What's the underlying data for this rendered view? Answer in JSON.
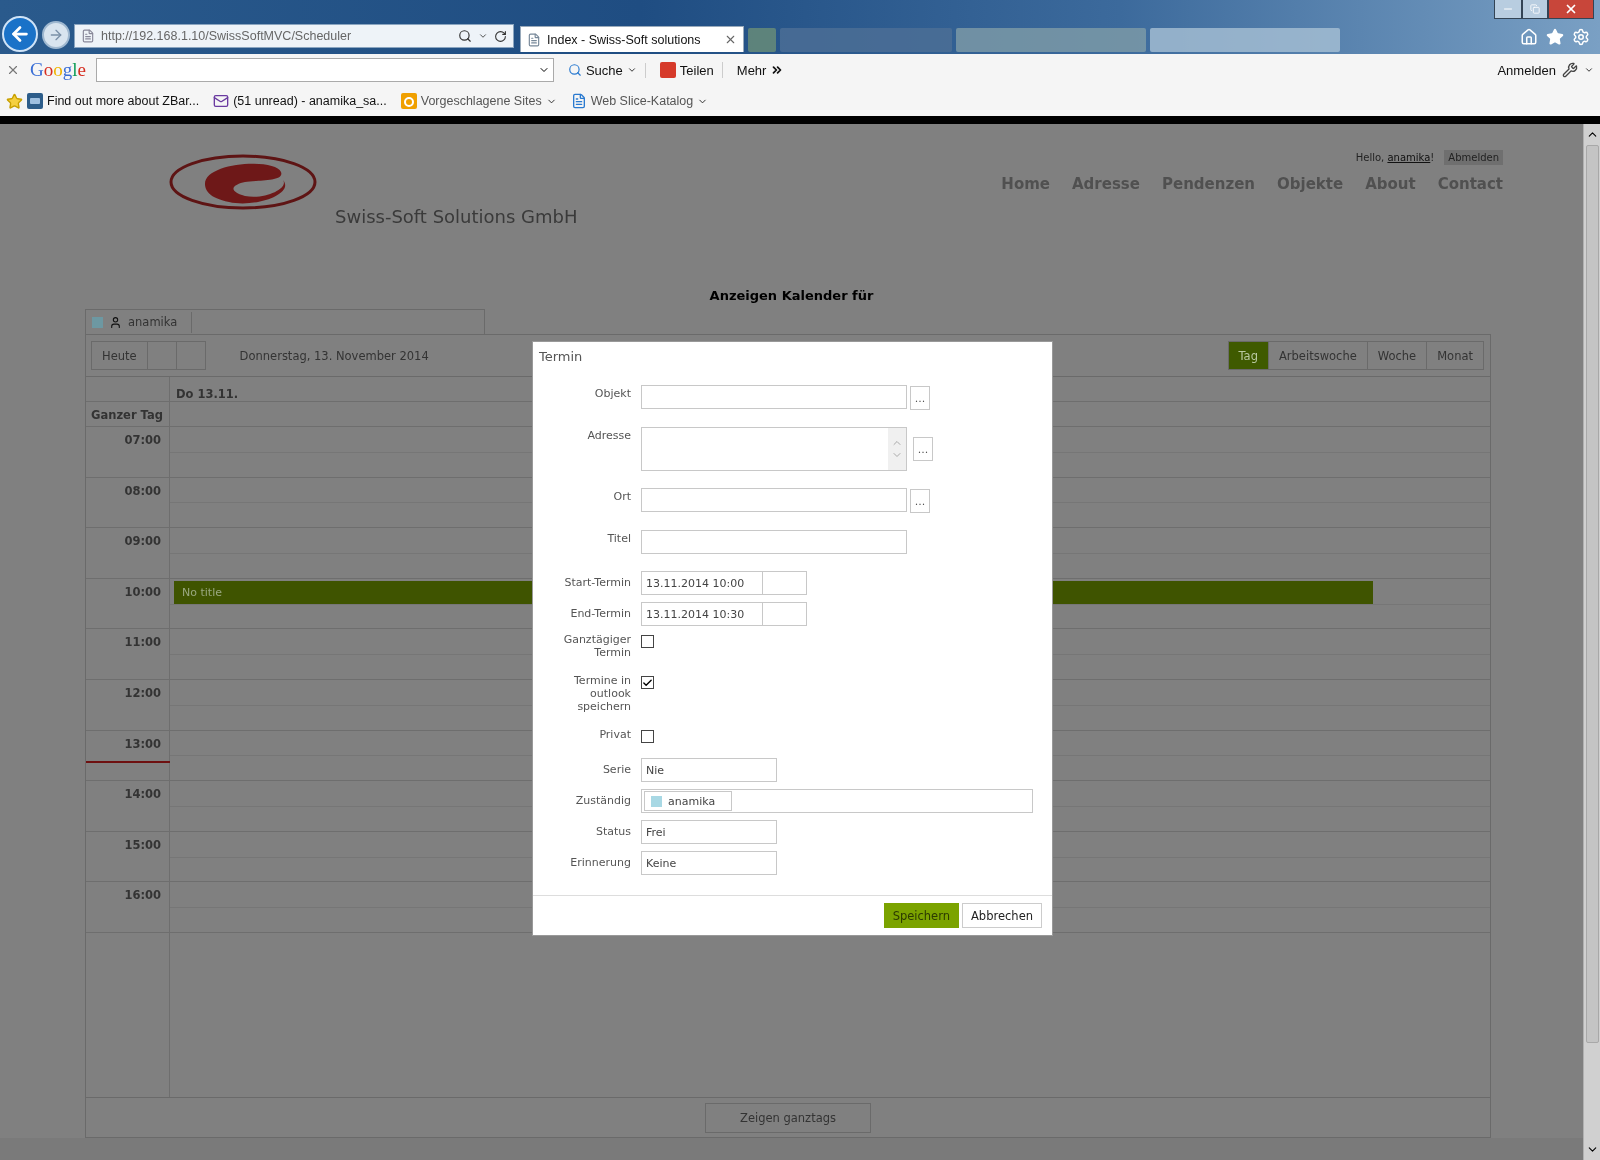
{
  "browser": {
    "address": "http://192.168.1.10/SwissSoftMVC/Scheduler",
    "tabs": [
      {
        "title": "Index - Swiss-Soft solutions",
        "selected": true
      }
    ],
    "google_toolbar": {
      "logo": "Google",
      "search_button": "Suche",
      "share_button": "Teilen",
      "more_button": "Mehr",
      "sign_in": "Anmelden"
    },
    "favorites": [
      {
        "label": "Find out more about ZBar...",
        "kind": "site",
        "dropdown": false
      },
      {
        "label": "(51 unread) - anamika_sa...",
        "kind": "mail",
        "dropdown": false
      },
      {
        "label": "Vorgeschlagene Sites",
        "kind": "suggested",
        "dropdown": true
      },
      {
        "label": "Web Slice-Katalog",
        "kind": "slice",
        "dropdown": true
      }
    ]
  },
  "header": {
    "greeting": "Hello,",
    "user": "anamika",
    "greeting_end": "!",
    "logout": "Abmelden",
    "company": "Swiss-Soft Solutions GmbH",
    "nav": [
      "Home",
      "Adresse",
      "Pendenzen",
      "Objekte",
      "About",
      "Contact"
    ]
  },
  "calendar": {
    "title": "Anzeigen Kalender für",
    "resources": [
      {
        "name": "anamika",
        "color": "#6d98a2"
      }
    ],
    "today_button": "Heute",
    "date": "Donnerstag, 13. November 2014",
    "views": [
      {
        "label": "Tag",
        "selected": true
      },
      {
        "label": "Arbeitswoche",
        "selected": false
      },
      {
        "label": "Woche",
        "selected": false
      },
      {
        "label": "Monat",
        "selected": false
      }
    ],
    "day_header": "Do 13.11.",
    "all_day_label": "Ganzer Tag",
    "hours": [
      {
        "label": "07:00",
        "current": false
      },
      {
        "label": "08:00",
        "current": false
      },
      {
        "label": "09:00",
        "current": false
      },
      {
        "label": "10:00",
        "current": false,
        "event": "No title"
      },
      {
        "label": "11:00",
        "current": false
      },
      {
        "label": "12:00",
        "current": false
      },
      {
        "label": "13:00",
        "current": true
      },
      {
        "label": "14:00",
        "current": false
      },
      {
        "label": "15:00",
        "current": false
      },
      {
        "label": "16:00",
        "current": false
      }
    ],
    "footer_button": "Zeigen ganztags"
  },
  "dialog": {
    "title": "Termin",
    "fields": [
      {
        "label": "Objekt",
        "kind": "text",
        "lookup_button": "..."
      },
      {
        "label": "Adresse",
        "kind": "textarea",
        "lookup_button": "..."
      },
      {
        "label": "Ort",
        "kind": "text",
        "lookup_button": "..."
      },
      {
        "label": "Titel",
        "kind": "text"
      },
      {
        "label": "Start-Termin",
        "kind": "datetime",
        "value": "13.11.2014 10:00"
      },
      {
        "label": "End-Termin",
        "kind": "datetime",
        "value": "13.11.2014 10:30"
      },
      {
        "label": "Ganztägiger Termin",
        "kind": "checkbox",
        "checked": false
      },
      {
        "label": "Termine in outlook speichern",
        "kind": "checkbox",
        "checked": true
      },
      {
        "label": "Privat",
        "kind": "checkbox",
        "checked": false
      },
      {
        "label": "Serie",
        "kind": "select",
        "value": "Nie"
      },
      {
        "label": "Zuständig",
        "kind": "multiselect",
        "tags": [
          {
            "name": "anamika",
            "color": "#a8d8e4"
          }
        ]
      },
      {
        "label": "Status",
        "kind": "select",
        "value": "Frei"
      },
      {
        "label": "Erinnerung",
        "kind": "select",
        "value": "Keine"
      }
    ],
    "buttons": [
      {
        "label": "Speichern",
        "primary": true
      },
      {
        "label": "Abbrechen",
        "primary": false
      }
    ]
  }
}
